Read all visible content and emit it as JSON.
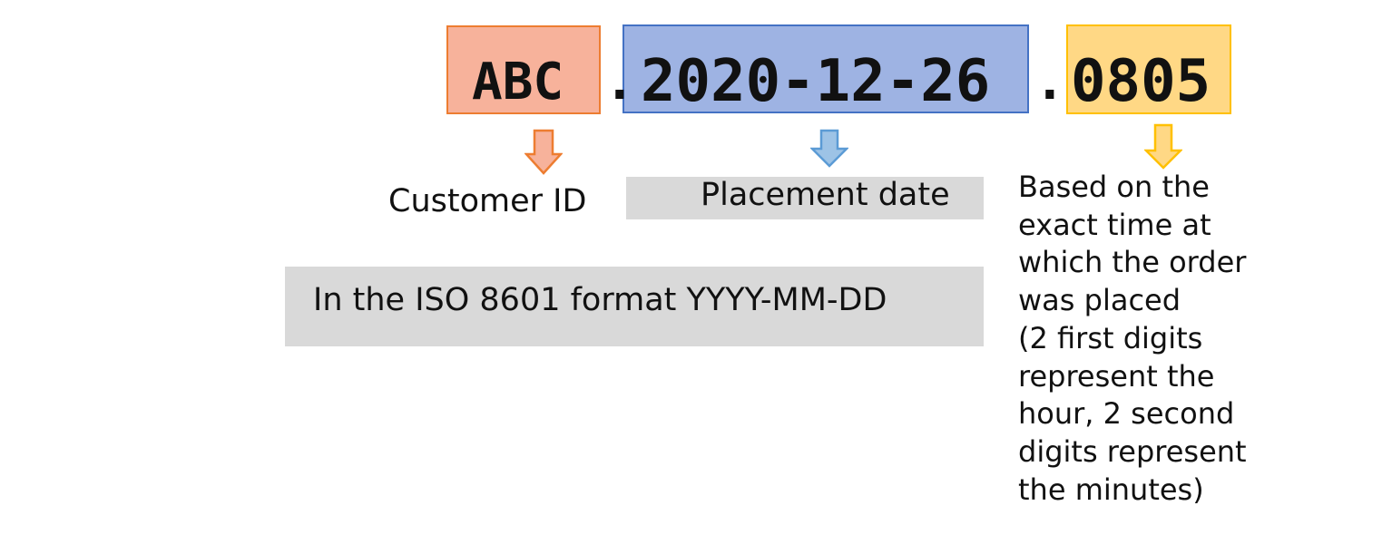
{
  "code": {
    "customer": "ABC",
    "separator1": ".",
    "date": "2020-12-26",
    "separator2": ".",
    "time": "0805"
  },
  "labels": {
    "customer_id": "Customer ID",
    "placement_date": "Placement date",
    "iso_note": "In the ISO 8601 format YYYY-MM-DD"
  },
  "time_note_lines": [
    "Based on the",
    "exact time at",
    "which the order",
    "was placed",
    "(2 first digits",
    "represent the",
    "hour, 2 second",
    "digits represent",
    "the minutes)"
  ],
  "colors": {
    "customer_fill": "#f7b29b",
    "customer_border": "#ed7d31",
    "date_fill": "#9eb3e3",
    "date_border": "#4472c4",
    "time_fill": "#ffd885",
    "time_border": "#ffc000",
    "note_background": "#d9d9d9"
  }
}
